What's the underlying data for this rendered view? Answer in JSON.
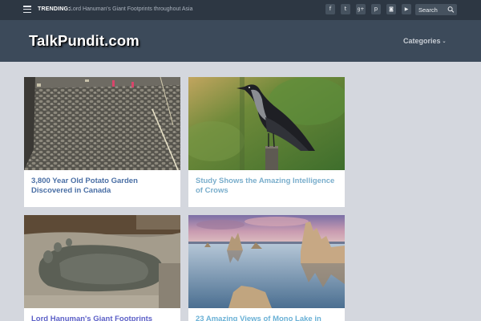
{
  "topbar": {
    "trending_label": "TRENDING:",
    "trending_text": "Lord Hanuman's Giant Footprints throughout Asia",
    "social": [
      {
        "icon": "facebook-icon",
        "glyph": "f"
      },
      {
        "icon": "twitter-icon",
        "glyph": "t"
      },
      {
        "icon": "googleplus-icon",
        "glyph": "g+"
      },
      {
        "icon": "pinterest-icon",
        "glyph": "p"
      },
      {
        "icon": "instagram-icon",
        "glyph": "◙"
      },
      {
        "icon": "youtube-icon",
        "glyph": "▶"
      }
    ],
    "search_placeholder": "Search"
  },
  "header": {
    "logo": "TalkPundit.com",
    "nav_categories": "Categories"
  },
  "articles": [
    {
      "title": "3,800 Year Old Potato Garden Discovered in Canada",
      "image": "excavated-garden-photo",
      "title_color": "#4a6fa5"
    },
    {
      "title": "Study Shows the Amazing Intelligence of Crows",
      "image": "crow-on-post-photo",
      "title_color": "#7aaecc"
    },
    {
      "title": "Lord Hanuman's Giant Footprints",
      "image": "giant-footprint-photo",
      "title_color": "#5b5fc7"
    },
    {
      "title": "23 Amazing Views of Mono Lake in",
      "image": "mono-lake-photo",
      "title_color": "#6ab1d6"
    }
  ],
  "colors": {
    "topbar_bg": "#2d3743",
    "header_bg": "#3c4a5a",
    "page_bg": "#d4d7de"
  }
}
